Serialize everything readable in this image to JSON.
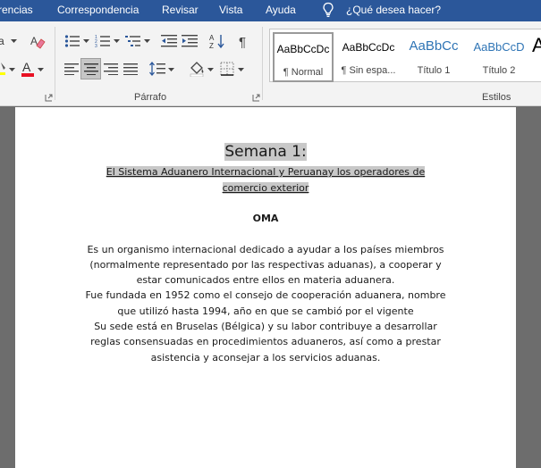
{
  "ribbon_tabs": [
    {
      "label": "rencias"
    },
    {
      "label": "Correspondencia"
    },
    {
      "label": "Revisar"
    },
    {
      "label": "Vista"
    },
    {
      "label": "Ayuda"
    }
  ],
  "tell_me": {
    "text": "¿Qué desea hacer?",
    "icon": "lightbulb-icon"
  },
  "groups": {
    "paragraph_label": "Párrafo",
    "styles_label": "Estilos"
  },
  "styles": [
    {
      "sample": "AaBbCcDc",
      "name": "¶ Normal",
      "selected": true,
      "color": "#000000"
    },
    {
      "sample": "AaBbCcDc",
      "name": "¶ Sin espa...",
      "selected": false,
      "color": "#000000"
    },
    {
      "sample": "AaBbCc",
      "name": "Título 1",
      "selected": false,
      "color": "#2e74b5"
    },
    {
      "sample": "AaBbCcD",
      "name": "Título 2",
      "selected": false,
      "color": "#2e74b5"
    },
    {
      "sample": "A",
      "name": "",
      "selected": false,
      "color": "#000000"
    }
  ],
  "colors": {
    "ribbon_accent": "#2b579a",
    "font_color_bar": "#e81123",
    "highlight_bar": "#ffff00",
    "selection_gray": "#c8c8c8"
  },
  "document": {
    "title": "Semana 1:",
    "subtitle_line1": "El Sistema Aduanero Internacional y Peruanay los operadores de",
    "subtitle_line2": "comercio exterior",
    "heading": "OMA",
    "body_lines": [
      "Es un organismo internacional dedicado a ayudar a los países miembros",
      "(normalmente  representado por las respectivas aduanas), a cooperar y",
      "estar comunicados entre ellos en materia aduanera.",
      "Fue fundada en 1952 como el consejo de cooperación aduanera, nombre",
      "que utilizó hasta 1994, año en que se cambió por el vigente",
      "Su sede está en Bruselas (Bélgica) y su labor contribuye a desarrollar",
      "reglas consensuadas en procedimientos aduaneros, así como a prestar",
      "asistencia y aconsejar a los servicios aduanas."
    ]
  }
}
